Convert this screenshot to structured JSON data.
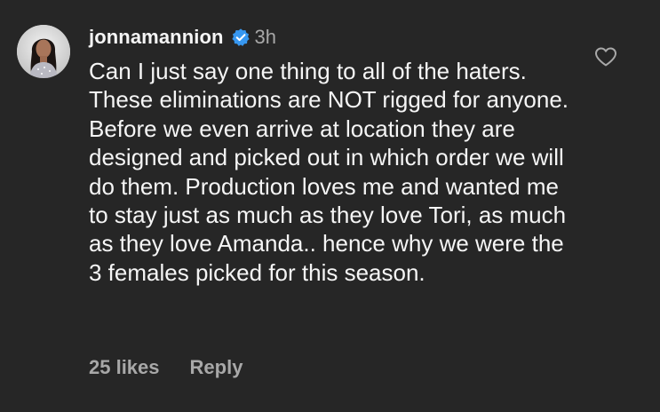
{
  "comment": {
    "username": "jonnamannion",
    "verified_icon": "verified-badge-icon",
    "timestamp": "3h",
    "text": "Can I just say one thing to all of the haters. These eliminations are NOT rigged for anyone. Before we even arrive at location they are designed and picked out in which order we will do them. Production loves me and wanted me to stay just as much as they love Tori, as much as they love Amanda.. hence why we were the 3 females picked for this season.",
    "likes_label": "25 likes",
    "reply_label": "Reply",
    "like_icon": "heart-outline-icon"
  },
  "colors": {
    "background": "#262626",
    "primary_text": "#f5f5f5",
    "secondary_text": "#a8a8a8",
    "verified_badge": "#3797f0"
  }
}
